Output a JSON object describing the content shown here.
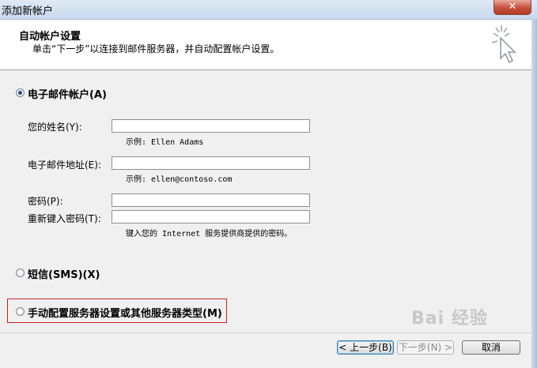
{
  "window": {
    "title": "添加新帐户",
    "close_glyph": "✕"
  },
  "header": {
    "title": "自动帐户设置",
    "subtitle": "单击“下一步”以连接到邮件服务器，并自动配置帐户设置。"
  },
  "options": {
    "email_account": {
      "label": "电子邮件帐户(A)",
      "selected": true
    },
    "sms": {
      "label": "短信(SMS)(X)",
      "selected": false
    },
    "manual": {
      "label": "手动配置服务器设置或其他服务器类型(M)",
      "selected": false
    }
  },
  "form": {
    "name": {
      "label": "您的姓名(Y):",
      "value": "",
      "hint": "示例: Ellen Adams"
    },
    "email": {
      "label": "电子邮件地址(E):",
      "value": "",
      "hint": "示例: ellen@contoso.com"
    },
    "password": {
      "label": "密码(P):",
      "value": ""
    },
    "confirm_password": {
      "label": "重新键入密码(T):",
      "value": ""
    },
    "password_hint": "键入您的 Internet 服务提供商提供的密码。"
  },
  "buttons": {
    "back": "< 上一步(B)",
    "next": "下一步(N) >",
    "cancel": "取消"
  },
  "watermark": "Bai 经验"
}
